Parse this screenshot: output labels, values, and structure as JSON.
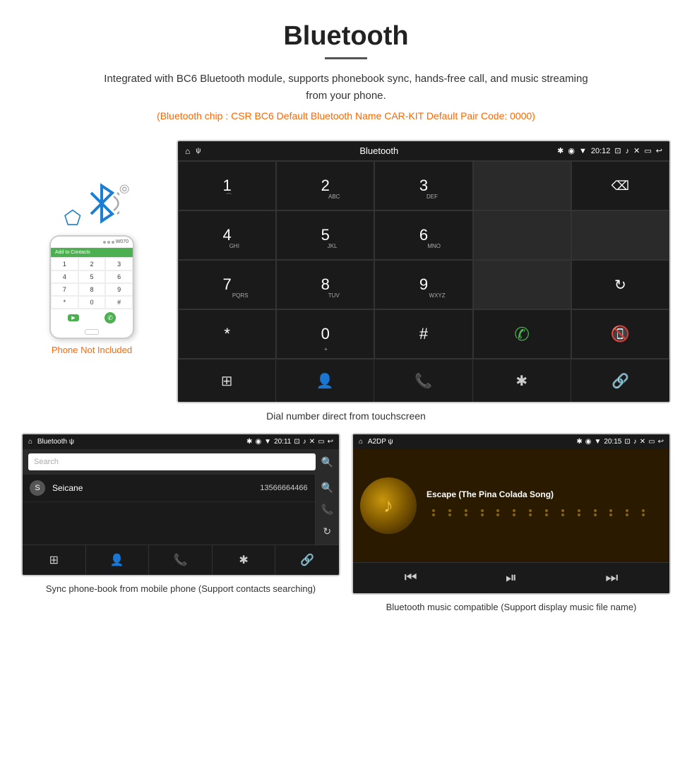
{
  "header": {
    "title": "Bluetooth",
    "description": "Integrated with BC6 Bluetooth module, supports phonebook sync, hands-free call, and music streaming from your phone.",
    "specs": "(Bluetooth chip : CSR BC6    Default Bluetooth Name CAR-KIT    Default Pair Code: 0000)"
  },
  "phone": {
    "not_included_label": "Phone Not Included",
    "add_to_contacts": "Add to Contacts",
    "carrier": "W070"
  },
  "car_screen": {
    "status_bar": {
      "title": "Bluetooth",
      "time": "20:12"
    },
    "dialpad": {
      "keys": [
        "1",
        "2",
        "3",
        "",
        "⌫",
        "4",
        "5",
        "6",
        "",
        "",
        "7",
        "8",
        "9",
        "",
        "↺",
        "*",
        "0",
        "#",
        "📞",
        "📵"
      ]
    },
    "toolbar_icons": [
      "⊞",
      "👤",
      "📞",
      "✱",
      "🔗"
    ]
  },
  "caption_main": "Dial number direct from touchscreen",
  "phonebook_screen": {
    "status_bar": {
      "left": "Bluetooth  ψ",
      "time": "20:11"
    },
    "search_placeholder": "Search",
    "contact": {
      "initial": "S",
      "name": "Seicane",
      "number": "13566664466"
    },
    "toolbar_icons": [
      "⊞",
      "👤",
      "📞",
      "✱",
      "🔗"
    ]
  },
  "caption_phonebook": "Sync phone-book from mobile phone\n(Support contacts searching)",
  "music_screen": {
    "status_bar": {
      "left": "A2DP  ψ",
      "time": "20:15"
    },
    "song_title": "Escape (The Pina Colada Song)",
    "controls": [
      "⏮",
      "⏭|",
      "⏭"
    ]
  },
  "caption_music": "Bluetooth music compatible\n(Support display music file name)"
}
